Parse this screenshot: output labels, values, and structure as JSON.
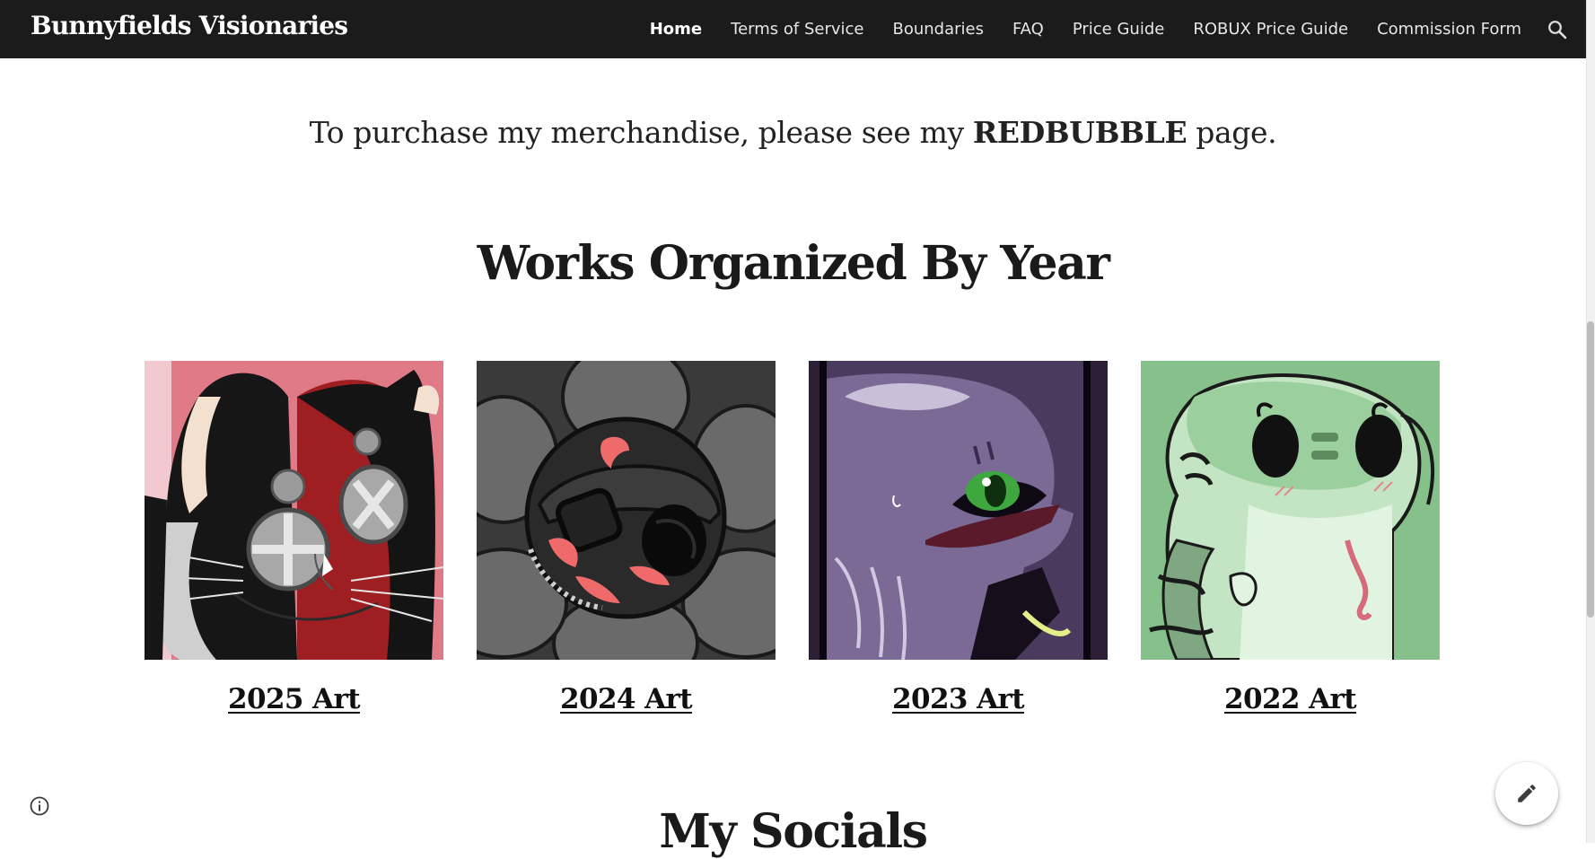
{
  "header": {
    "site_title": "Bunnyfields Visionaries",
    "nav": [
      {
        "label": "Home",
        "active": true
      },
      {
        "label": "Terms of Service",
        "active": false
      },
      {
        "label": "Boundaries",
        "active": false
      },
      {
        "label": "FAQ",
        "active": false
      },
      {
        "label": "Price Guide",
        "active": false
      },
      {
        "label": "ROBUX Price Guide",
        "active": false
      },
      {
        "label": "Commission Form",
        "active": false
      }
    ],
    "search_icon": "search-icon"
  },
  "main": {
    "intro": {
      "prefix": "To purchase my merchandise, please see my ",
      "link": "REDBUBBLE",
      "suffix": " page."
    },
    "works_heading": "Works Organized By Year",
    "works": [
      {
        "label": "2025 Art",
        "image": "black-and-red-bunny-artwork"
      },
      {
        "label": "2024 Art",
        "image": "dark-flower-creature-artwork"
      },
      {
        "label": "2023 Art",
        "image": "purple-creature-artwork"
      },
      {
        "label": "2022 Art",
        "image": "green-snake-artwork"
      }
    ],
    "socials_heading": "My Socials"
  },
  "controls": {
    "info_icon": "info-icon",
    "edit_icon": "pencil-icon"
  },
  "colors": {
    "header_bg": "#1b1b1b",
    "text": "#222222",
    "card_2025_bg": "#e07a86",
    "card_2024_bg": "#3a3a3a",
    "card_2023_bg": "#4a3a5e",
    "card_2022_bg": "#86c08a"
  }
}
